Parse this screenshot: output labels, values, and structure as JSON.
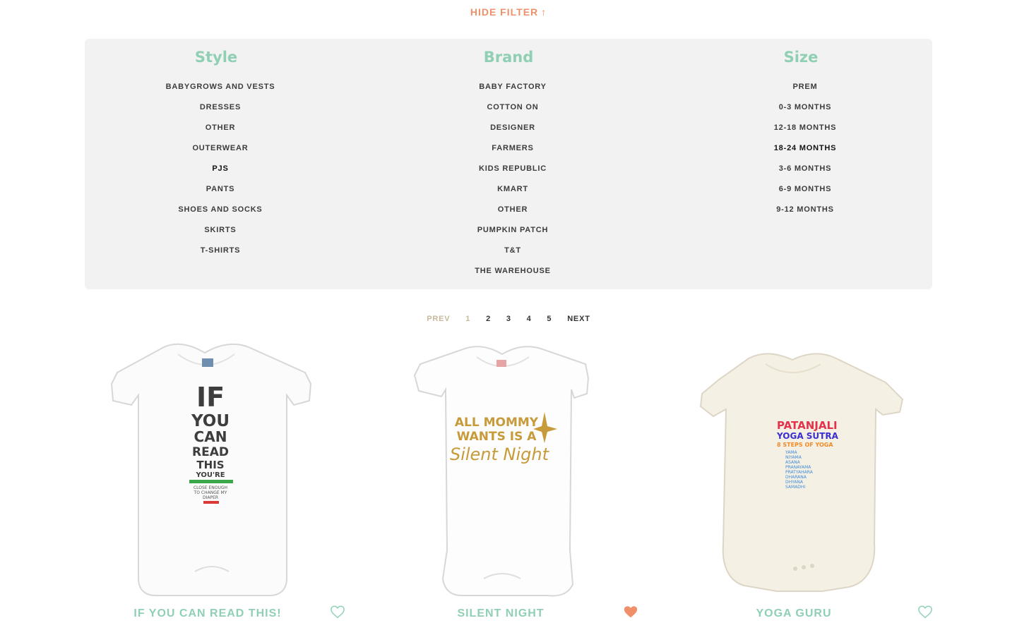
{
  "filter_toggle": {
    "label": "HIDE FILTER",
    "arrow": "↑"
  },
  "filters": {
    "style": {
      "title": "Style",
      "items": [
        "BABYGROWS AND VESTS",
        "DRESSES",
        "OTHER",
        "OUTERWEAR",
        "PJS",
        "PANTS",
        "SHOES AND SOCKS",
        "SKIRTS",
        "T-SHIRTS"
      ]
    },
    "brand": {
      "title": "Brand",
      "items": [
        "BABY FACTORY",
        "COTTON ON",
        "DESIGNER",
        "FARMERS",
        "KIDS REPUBLIC",
        "KMART",
        "OTHER",
        "PUMPKIN PATCH",
        "T&T",
        "THE WAREHOUSE"
      ]
    },
    "size": {
      "title": "Size",
      "items": [
        "PREM",
        "0-3 MONTHS",
        "12-18 MONTHS",
        "18-24 MONTHS",
        "3-6 MONTHS",
        "6-9 MONTHS",
        "9-12 MONTHS"
      ]
    }
  },
  "pagination": {
    "prev": "PREV",
    "pages": [
      "1",
      "2",
      "3",
      "4",
      "5"
    ],
    "next": "NEXT",
    "current": "1"
  },
  "products": [
    {
      "name": "IF YOU CAN READ THIS!",
      "favorited": false,
      "print": [
        "IF",
        "YOU",
        "CAN",
        "READ",
        "THIS",
        "YOU'RE",
        "CLOSE ENOUGH",
        "TO CHANGE MY",
        "DIAPER"
      ]
    },
    {
      "name": "SILENT NIGHT",
      "favorited": true,
      "print": [
        "ALL MOMMY",
        "WANTS IS A",
        "Silent Night"
      ]
    },
    {
      "name": "YOGA GURU",
      "favorited": false,
      "print": [
        "PATANJALI",
        "YOGA SUTRA",
        "8 STEPS OF YOGA",
        "YAMA",
        "NIYAMA",
        "ASANA",
        "PRANAYAMA",
        "PRATYAHARA",
        "DHARANA",
        "DHYANA",
        "SAMADHI"
      ]
    }
  ],
  "colors": {
    "accent_mint": "#8fd0b4",
    "accent_coral": "#f0906a",
    "panel_bg": "#f2f2f2"
  }
}
